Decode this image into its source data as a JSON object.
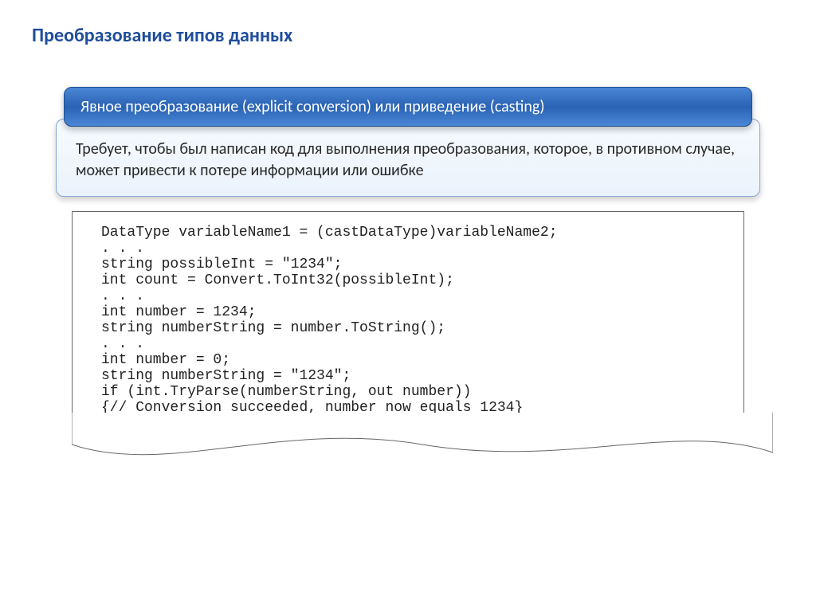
{
  "title": "Преобразование типов данных",
  "banner": "Явное преобразование (explicit conversion) или приведение (casting)",
  "description": "Требует, чтобы был написан код для выполнения преобразования, которое, в противном случае, может привести к потере информации или ошибке",
  "code": "DataType variableName1 = (castDataType)variableName2;\n. . .\nstring possibleInt = \"1234\";\nint count = Convert.ToInt32(possibleInt);\n. . .\nint number = 1234;\nstring numberString = number.ToString();\n. . .\nint number = 0;\nstring numberString = \"1234\";\nif (int.TryParse(numberString, out number))\n{// Conversion succeeded, number now equals 1234}"
}
